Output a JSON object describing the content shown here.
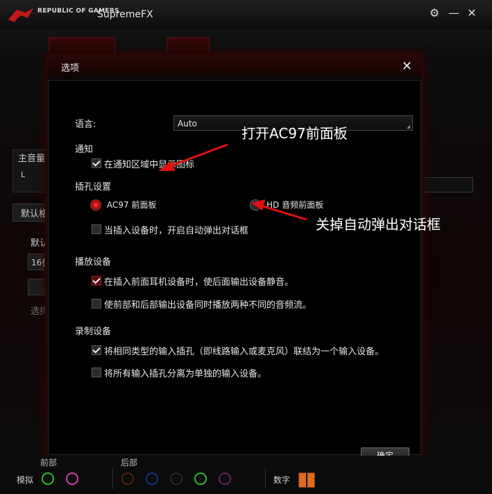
{
  "window": {
    "brand": "REPUBLIC OF GAMERS",
    "title": "SupremeFX"
  },
  "background": {
    "master_volume_label": "主音量",
    "l_label": "L",
    "default_label": "默认格",
    "default_label_2": "默认",
    "format_value": "16位",
    "select_hint": "选择"
  },
  "dialog": {
    "title": "选项",
    "language_label": "语言:",
    "language_value": "Auto",
    "notify_section": "通知",
    "notify_tray_icon": {
      "label": "在通知区域中显示图标",
      "checked": true
    },
    "jack_section": "插孔设置",
    "radio_ac97": {
      "label": "AC97 前面板",
      "selected": true
    },
    "radio_hd": {
      "label": "HD 音频前面板",
      "selected": false
    },
    "auto_popup": {
      "label": "当插入设备时，开启自动弹出对话框",
      "checked": false
    },
    "playback_section": "播放设备",
    "mute_rear": {
      "label": "在插入前面耳机设备时，使后面输出设备静音。",
      "checked": true
    },
    "multi_stream": {
      "label": "使前部和后部输出设备同时播放两种不同的音频流。",
      "checked": false
    },
    "record_section": "录制设备",
    "combine_inputs": {
      "label": "将相同类型的输入插孔（即线路输入或麦克风）联结为一个输入设备。",
      "checked": true
    },
    "separate_inputs": {
      "label": "将所有输入插孔分离为单独的输入设备。",
      "checked": false
    },
    "ok_button": "确定"
  },
  "annotations": {
    "open_ac97": "打开AC97前面板",
    "disable_popup": "关掉自动弹出对话框",
    "arrow_color": "#e01010"
  },
  "bottom": {
    "front_label": "前部",
    "rear_label": "后部",
    "analog_label": "模拟",
    "digital_label": "数字",
    "front_jacks": [
      "#2ec02e",
      "#d040b0"
    ],
    "rear_jacks": [
      "#5a2010",
      "#103a7a",
      "#2a2a2a",
      "#2ec02e",
      "#6a2060"
    ]
  }
}
